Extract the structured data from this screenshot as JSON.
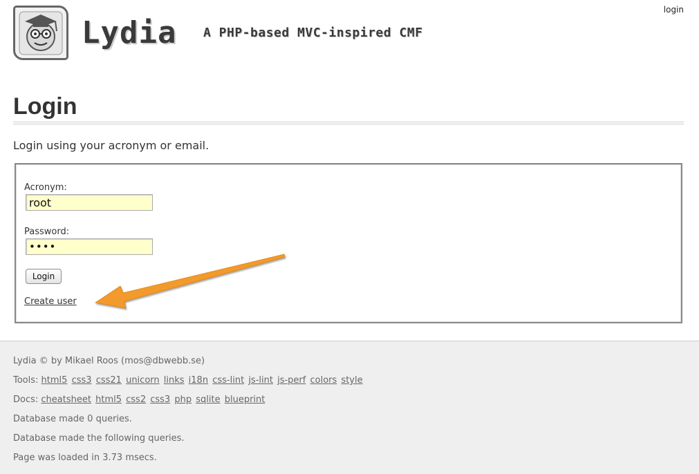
{
  "header": {
    "site_title": "Lydia",
    "slogan": "A PHP-based MVC-inspired CMF",
    "login_link": "login"
  },
  "main": {
    "page_title": "Login",
    "intro": "Login using your acronym or email."
  },
  "form": {
    "acronym_label": "Acronym:",
    "acronym_value": "root",
    "password_label": "Password:",
    "password_value": "••••",
    "login_button": "Login",
    "create_user_link": "Create user"
  },
  "footer": {
    "copyright": "Lydia © by Mikael Roos (mos@dbwebb.se)",
    "tools_label": "Tools:",
    "tools_links": [
      "html5",
      "css3",
      "css21",
      "unicorn",
      "links",
      "i18n",
      "css-lint",
      "js-lint",
      "js-perf",
      "colors",
      "style"
    ],
    "docs_label": "Docs:",
    "docs_links": [
      "cheatsheet",
      "html5",
      "css2",
      "css3",
      "php",
      "sqlite",
      "blueprint"
    ],
    "db_queries": "Database made 0 queries.",
    "db_following": "Database made the following queries.",
    "load_time": "Page was loaded in 3.73 msecs."
  },
  "colors": {
    "input_background": "#ffffcc",
    "arrow": "#f39a2c",
    "footer_background": "#efefef"
  }
}
